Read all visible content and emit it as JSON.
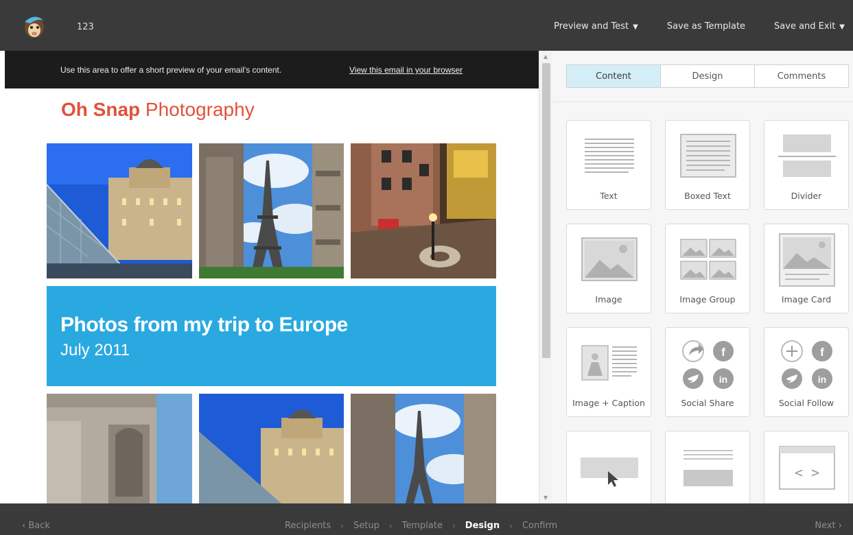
{
  "header": {
    "campaign_name": "123",
    "preview_label": "Preview and Test",
    "save_template_label": "Save as Template",
    "save_exit_label": "Save and Exit"
  },
  "email": {
    "preheader_text": "Use this area to offer a short preview of your email's content.",
    "browser_link": "View this email in your browser",
    "brand_bold": "Oh Snap",
    "brand_rest": " Photography",
    "hero_title": "Photos from my trip to Europe",
    "hero_subtitle": "July 2011"
  },
  "panel": {
    "tabs": [
      {
        "label": "Content",
        "active": true
      },
      {
        "label": "Design",
        "active": false
      },
      {
        "label": "Comments",
        "active": false
      }
    ],
    "blocks": [
      {
        "label": "Text",
        "icon": "text-block-icon"
      },
      {
        "label": "Boxed Text",
        "icon": "boxed-text-icon"
      },
      {
        "label": "Divider",
        "icon": "divider-icon"
      },
      {
        "label": "Image",
        "icon": "image-icon"
      },
      {
        "label": "Image Group",
        "icon": "image-group-icon"
      },
      {
        "label": "Image Card",
        "icon": "image-card-icon"
      },
      {
        "label": "Image + Caption",
        "icon": "image-caption-icon"
      },
      {
        "label": "Social Share",
        "icon": "social-share-icon"
      },
      {
        "label": "Social Follow",
        "icon": "social-follow-icon"
      },
      {
        "label": "",
        "icon": "button-block-icon"
      },
      {
        "label": "",
        "icon": "footer-block-icon"
      },
      {
        "label": "",
        "icon": "code-block-icon"
      }
    ]
  },
  "footer": {
    "back_label": "Back",
    "steps": [
      "Recipients",
      "Setup",
      "Template",
      "Design",
      "Confirm"
    ],
    "current_step": "Design",
    "next_label": "Next"
  },
  "colors": {
    "brand_red": "#e2513b",
    "hero_blue": "#2aa9e0",
    "active_tab": "#d4eef7",
    "bar_dark": "#3a3a3a"
  }
}
